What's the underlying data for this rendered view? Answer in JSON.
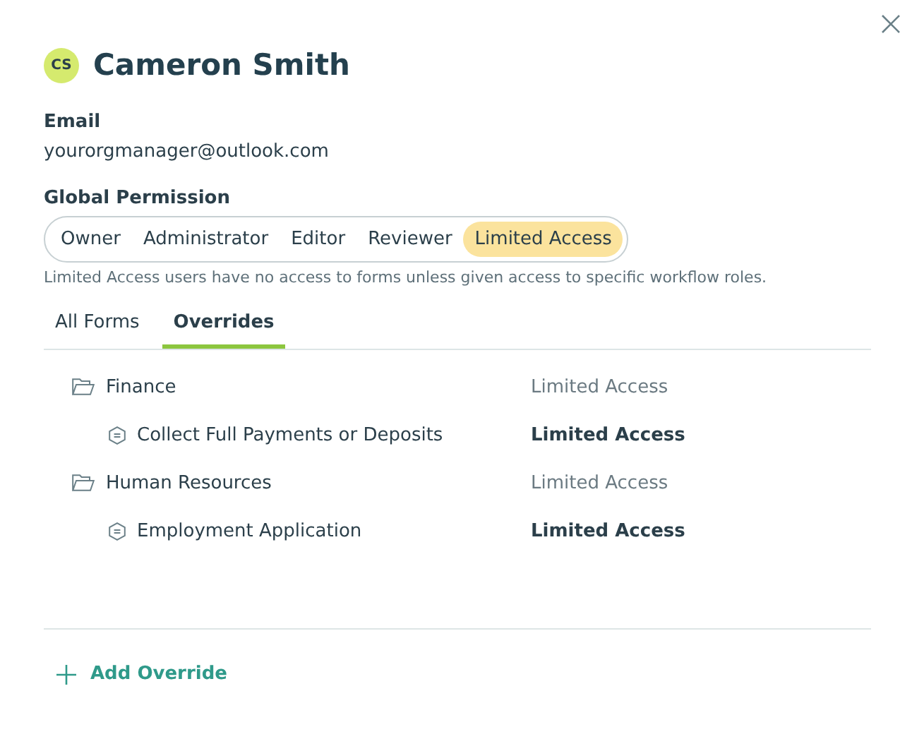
{
  "user": {
    "initials": "CS",
    "name": "Cameron Smith"
  },
  "email": {
    "label": "Email",
    "value": "yourorgmanager@outlook.com"
  },
  "global_permission": {
    "label": "Global Permission",
    "options": [
      {
        "label": "Owner",
        "selected": false
      },
      {
        "label": "Administrator",
        "selected": false
      },
      {
        "label": "Editor",
        "selected": false
      },
      {
        "label": "Reviewer",
        "selected": false
      },
      {
        "label": "Limited Access",
        "selected": true
      }
    ],
    "description": "Limited Access users have no access to forms unless given access to specific workflow roles."
  },
  "tabs": [
    {
      "label": "All Forms",
      "selected": false
    },
    {
      "label": "Overrides",
      "selected": true
    }
  ],
  "overrides": [
    {
      "kind": "folder",
      "name": "Finance",
      "access": "Limited Access",
      "children": [
        {
          "kind": "form",
          "name": "Collect Full Payments or Deposits",
          "access": "Limited Access"
        }
      ]
    },
    {
      "kind": "folder",
      "name": "Human Resources",
      "access": "Limited Access",
      "children": [
        {
          "kind": "form",
          "name": "Employment Application",
          "access": "Limited Access"
        }
      ]
    }
  ],
  "add_button": {
    "label": "Add Override"
  }
}
